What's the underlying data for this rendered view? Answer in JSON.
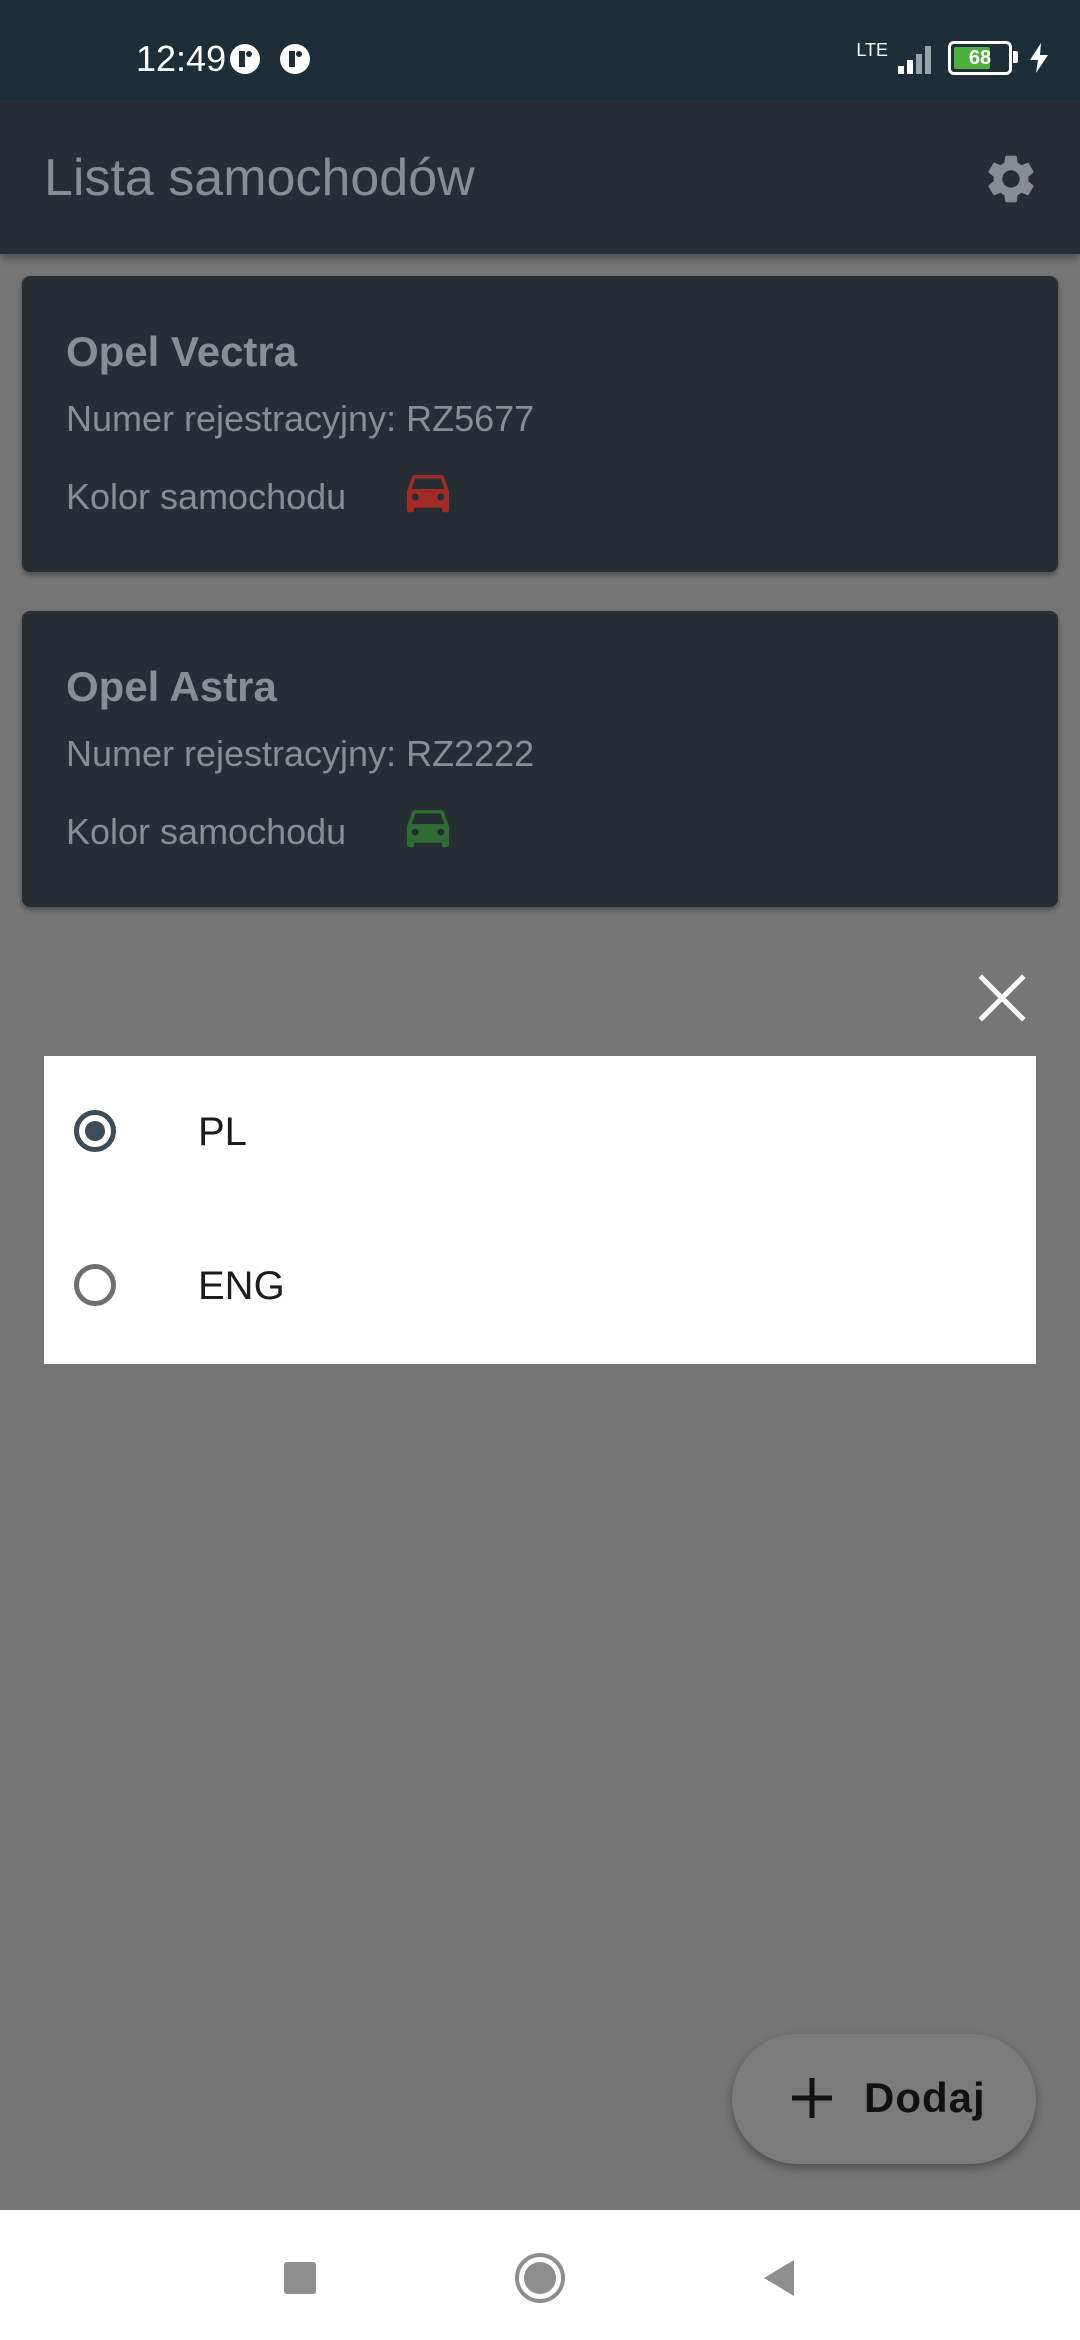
{
  "status_bar": {
    "time": "12:49",
    "network": "LTE",
    "battery": "68"
  },
  "app_bar": {
    "title": "Lista samochodów"
  },
  "cars": [
    {
      "name": "Opel Vectra",
      "registration": "Numer rejestracyjny: RZ5677",
      "color_label": "Kolor samochodu",
      "color": "#a32b26"
    },
    {
      "name": "Opel Astra",
      "registration": "Numer rejestracyjny: RZ2222",
      "color_label": "Kolor samochodu",
      "color": "#2f6b33"
    }
  ],
  "language_dialog": {
    "options": [
      {
        "label": "PL",
        "selected": true
      },
      {
        "label": "ENG",
        "selected": false
      }
    ]
  },
  "fab": {
    "label": "Dodaj"
  },
  "icons": {
    "settings": "gear-icon",
    "close": "close-icon",
    "add": "plus-icon",
    "car": "car-icon",
    "nav_recents": "square-icon",
    "nav_home": "circle-icon",
    "nav_back": "triangle-back-icon"
  },
  "colors": {
    "status_bar": "#1d2e38",
    "app_bar": "#262d33",
    "card": "#262d33",
    "scrim": "#767676",
    "radio_checked": "#3d4c56"
  }
}
